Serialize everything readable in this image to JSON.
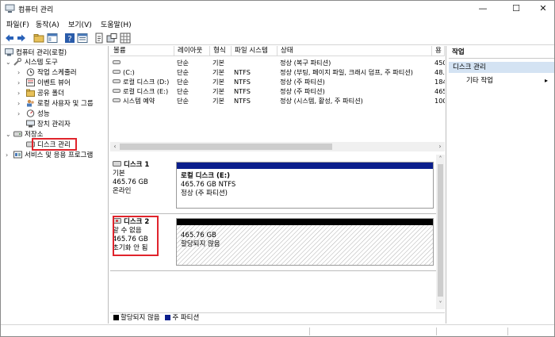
{
  "window": {
    "title": "컴퓨터 관리",
    "controls": {
      "minimize": "—",
      "maximize": "☐",
      "close": "✕"
    }
  },
  "menubar": {
    "items": [
      "파일(F)",
      "동작(A)",
      "보기(V)",
      "도움말(H)"
    ]
  },
  "toolbar": {
    "buttons": [
      "back-arrow-icon",
      "forward-arrow-icon",
      "up-folder-icon",
      "console-tree-icon",
      "help-icon",
      "properties-icon",
      "refresh-icon",
      "settings-icon",
      "grid-icon"
    ]
  },
  "tree": {
    "root": "컴퓨터 관리(로컬)",
    "system_tools": "시스템 도구",
    "task_scheduler": "작업 스케줄러",
    "event_viewer": "이벤트 뷰어",
    "shared_folders": "공유 폴더",
    "local_users_groups": "로컬 사용자 및 그룹",
    "performance": "성능",
    "device_manager": "장치 관리자",
    "storage": "저장소",
    "disk_management": "디스크 관리",
    "services_apps": "서비스 및 응용 프로그램"
  },
  "volume_table": {
    "columns": [
      "볼륨",
      "레이아웃",
      "형식",
      "파일 시스템",
      "상태",
      "용"
    ],
    "rows": [
      {
        "volume": "",
        "layout": "단순",
        "type": "기본",
        "fs": "",
        "status": "정상 (복구 파티션)",
        "capacity": "450"
      },
      {
        "volume": "(C:)",
        "layout": "단순",
        "type": "기본",
        "fs": "NTFS",
        "status": "정상 (부팅, 페이지 파일, 크래시 덤프, 주 파티션)",
        "capacity": "48.0"
      },
      {
        "volume": "로컬 디스크 (D:)",
        "layout": "단순",
        "type": "기본",
        "fs": "NTFS",
        "status": "정상 (주 파티션)",
        "capacity": "184"
      },
      {
        "volume": "로컬 디스크 (E:)",
        "layout": "단순",
        "type": "기본",
        "fs": "NTFS",
        "status": "정상 (주 파티션)",
        "capacity": "465"
      },
      {
        "volume": "시스템 예약",
        "layout": "단순",
        "type": "기본",
        "fs": "NTFS",
        "status": "정상 (시스템, 활성, 주 파티션)",
        "capacity": "100"
      }
    ]
  },
  "disks": [
    {
      "name": "디스크 1",
      "kind": "기본",
      "size": "465.76 GB",
      "state": "온라인",
      "partition": {
        "title": "로컬 디스크  (E:)",
        "detail": "465.76 GB NTFS",
        "status": "정상 (주 파티션)",
        "bar_color": "#0b1f8c"
      }
    },
    {
      "name": "디스크 2",
      "kind": "알 수 없음",
      "size": "465.76 GB",
      "state": "초기화 안 됨",
      "partition": {
        "size": "465.76 GB",
        "status": "할당되지 않음",
        "bar_color": "#000000"
      }
    }
  ],
  "legend": {
    "unallocated": "할당되지 않음",
    "primary": "주 파티션",
    "unallocated_color": "#000000",
    "primary_color": "#0b1f8c"
  },
  "actions": {
    "header": "작업",
    "section": "디스크 관리",
    "more": "기타 작업",
    "section_bg": "#d4e3f3"
  },
  "highlight_color": "#e0242c"
}
